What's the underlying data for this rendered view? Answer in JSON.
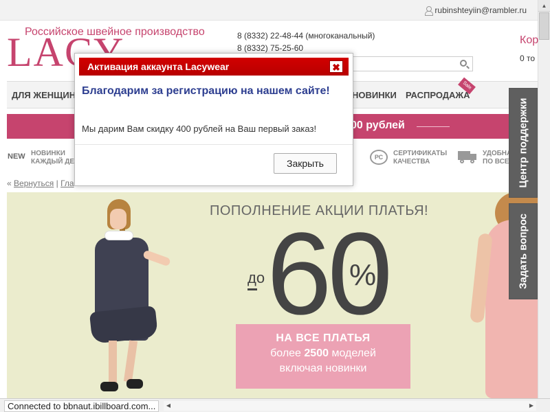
{
  "user": {
    "email": "rubinshteyiin@rambler.ru"
  },
  "header": {
    "tagline": "Российское швейное производство",
    "logo": "LACY",
    "phones": [
      "8 (8332) 22-48-44 (многоканальный)",
      "8 (8332) 75-25-60"
    ],
    "cart_label": "Кор",
    "cart_count": "0 то"
  },
  "nav": {
    "items": [
      {
        "label": "ДЛЯ ЖЕНЩИН"
      },
      {
        "label": "НОВИНКИ"
      },
      {
        "label": "РАСПРОДАЖА"
      }
    ],
    "sale_badge": "Sale"
  },
  "promo": {
    "text": "00 рублей"
  },
  "features": {
    "new_label": "NEW",
    "new_text": [
      "НОВИНКИ",
      "КАЖДЫЙ ДЕ"
    ],
    "cert_text": [
      "СЕРТИФИКАТЫ",
      "КАЧЕСТВА"
    ],
    "delivery_text": [
      "УДОБНА",
      "ПО ВСЕЙ"
    ],
    "cert_icon_text": "РС"
  },
  "breadcrumb": {
    "back_prefix": "«",
    "back": "Вернуться",
    "separator": "|",
    "home": "Гла"
  },
  "banner": {
    "headline": "ПОПОЛНЕНИЕ АКЦИИ ПЛАТЬЯ!",
    "prefix": "до",
    "number": "60",
    "percent": "%",
    "line1": "НА ВСЕ ПЛАТЬЯ",
    "line2_prefix": "более",
    "line2_bold": "2500",
    "line2_suffix": "моделей",
    "line3": "включая новинки"
  },
  "side_tabs": {
    "support": "Центр поддержки",
    "question": "Задать вопрос"
  },
  "status": {
    "text": "Connected to bbnaut.ibillboard.com..."
  },
  "modal": {
    "title": "Активация аккаунта Lacywear",
    "close_glyph": "✖",
    "heading": "Благодарим за регистрацию на нашем сайте!",
    "body": "Мы дарим Вам скидку 400 рублей на Ваш первый заказ!",
    "button": "Закрыть"
  },
  "colors": {
    "brand": "#c6446e",
    "modal_header": "#c00000",
    "heading_blue": "#2d3e90",
    "banner_bg": "#ebeccd",
    "banner_box": "#eca2b4",
    "side_tab": "#5f5f5f"
  }
}
